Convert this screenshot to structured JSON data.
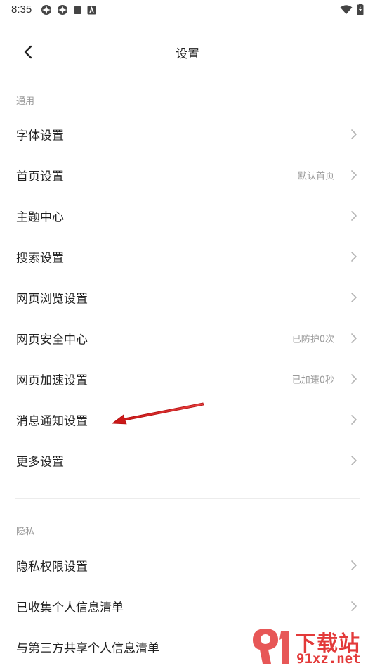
{
  "status_bar": {
    "time": "8:35"
  },
  "header": {
    "title": "设置"
  },
  "sections": {
    "general": {
      "label": "通用",
      "items": [
        {
          "label": "字体设置",
          "value": ""
        },
        {
          "label": "首页设置",
          "value": "默认首页"
        },
        {
          "label": "主题中心",
          "value": ""
        },
        {
          "label": "搜索设置",
          "value": ""
        },
        {
          "label": "网页浏览设置",
          "value": ""
        },
        {
          "label": "网页安全中心",
          "value": "已防护0次"
        },
        {
          "label": "网页加速设置",
          "value": "已加速0秒"
        },
        {
          "label": "消息通知设置",
          "value": ""
        },
        {
          "label": "更多设置",
          "value": ""
        }
      ]
    },
    "privacy": {
      "label": "隐私",
      "items": [
        {
          "label": "隐私权限设置",
          "value": ""
        },
        {
          "label": "已收集个人信息清单",
          "value": ""
        },
        {
          "label": "与第三方共享个人信息清单",
          "value": ""
        }
      ]
    }
  },
  "watermark": {
    "top": "下载站",
    "bottom": "91xz.net"
  },
  "colors": {
    "arrow": "#d42020",
    "watermark": "#e33a3a",
    "secondary_text": "#9a9a9a"
  }
}
